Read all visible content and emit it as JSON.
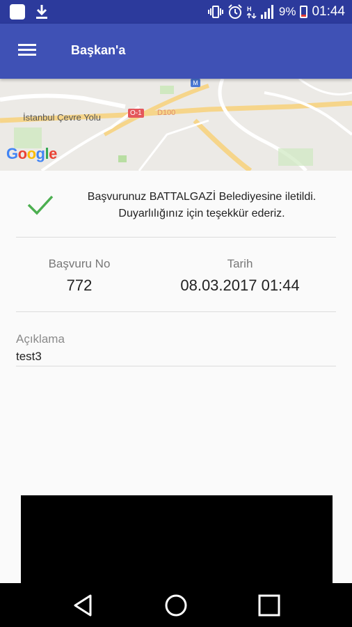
{
  "status_bar": {
    "battery_percent": "9%",
    "time": "01:44",
    "icons": [
      "app-icon",
      "download-icon",
      "vibrate-icon",
      "alarm-icon",
      "hd-signal-icon",
      "cell-signal-icon",
      "battery-icon"
    ]
  },
  "app_bar": {
    "title": "Başkan'a",
    "menu_icon": "hamburger-menu-icon"
  },
  "map": {
    "road_label": "İstanbul Çevre Yolu",
    "route_shield": "O-1",
    "road_number": "D100",
    "metro_marker": "M",
    "google_logo": [
      "G",
      "o",
      "o",
      "g",
      "l",
      "e"
    ]
  },
  "result": {
    "message": "Başvurunuz BATTALGAZİ Belediyesine iletildi. Duyarlılığınız için teşekkür ederiz.",
    "status_icon": "check-icon"
  },
  "details": {
    "basvuru_no_label": "Başvuru No",
    "basvuru_no": "772",
    "tarih_label": "Tarih",
    "tarih": "08.03.2017 01:44",
    "aciklama_label": "Açıklama",
    "aciklama": "test3"
  },
  "nav_bar": {
    "icons": [
      "back-icon",
      "home-icon",
      "recents-icon"
    ]
  },
  "colors": {
    "status_bar": "#2c3a9c",
    "app_bar": "#3f51b5",
    "check": "#4caf50"
  }
}
